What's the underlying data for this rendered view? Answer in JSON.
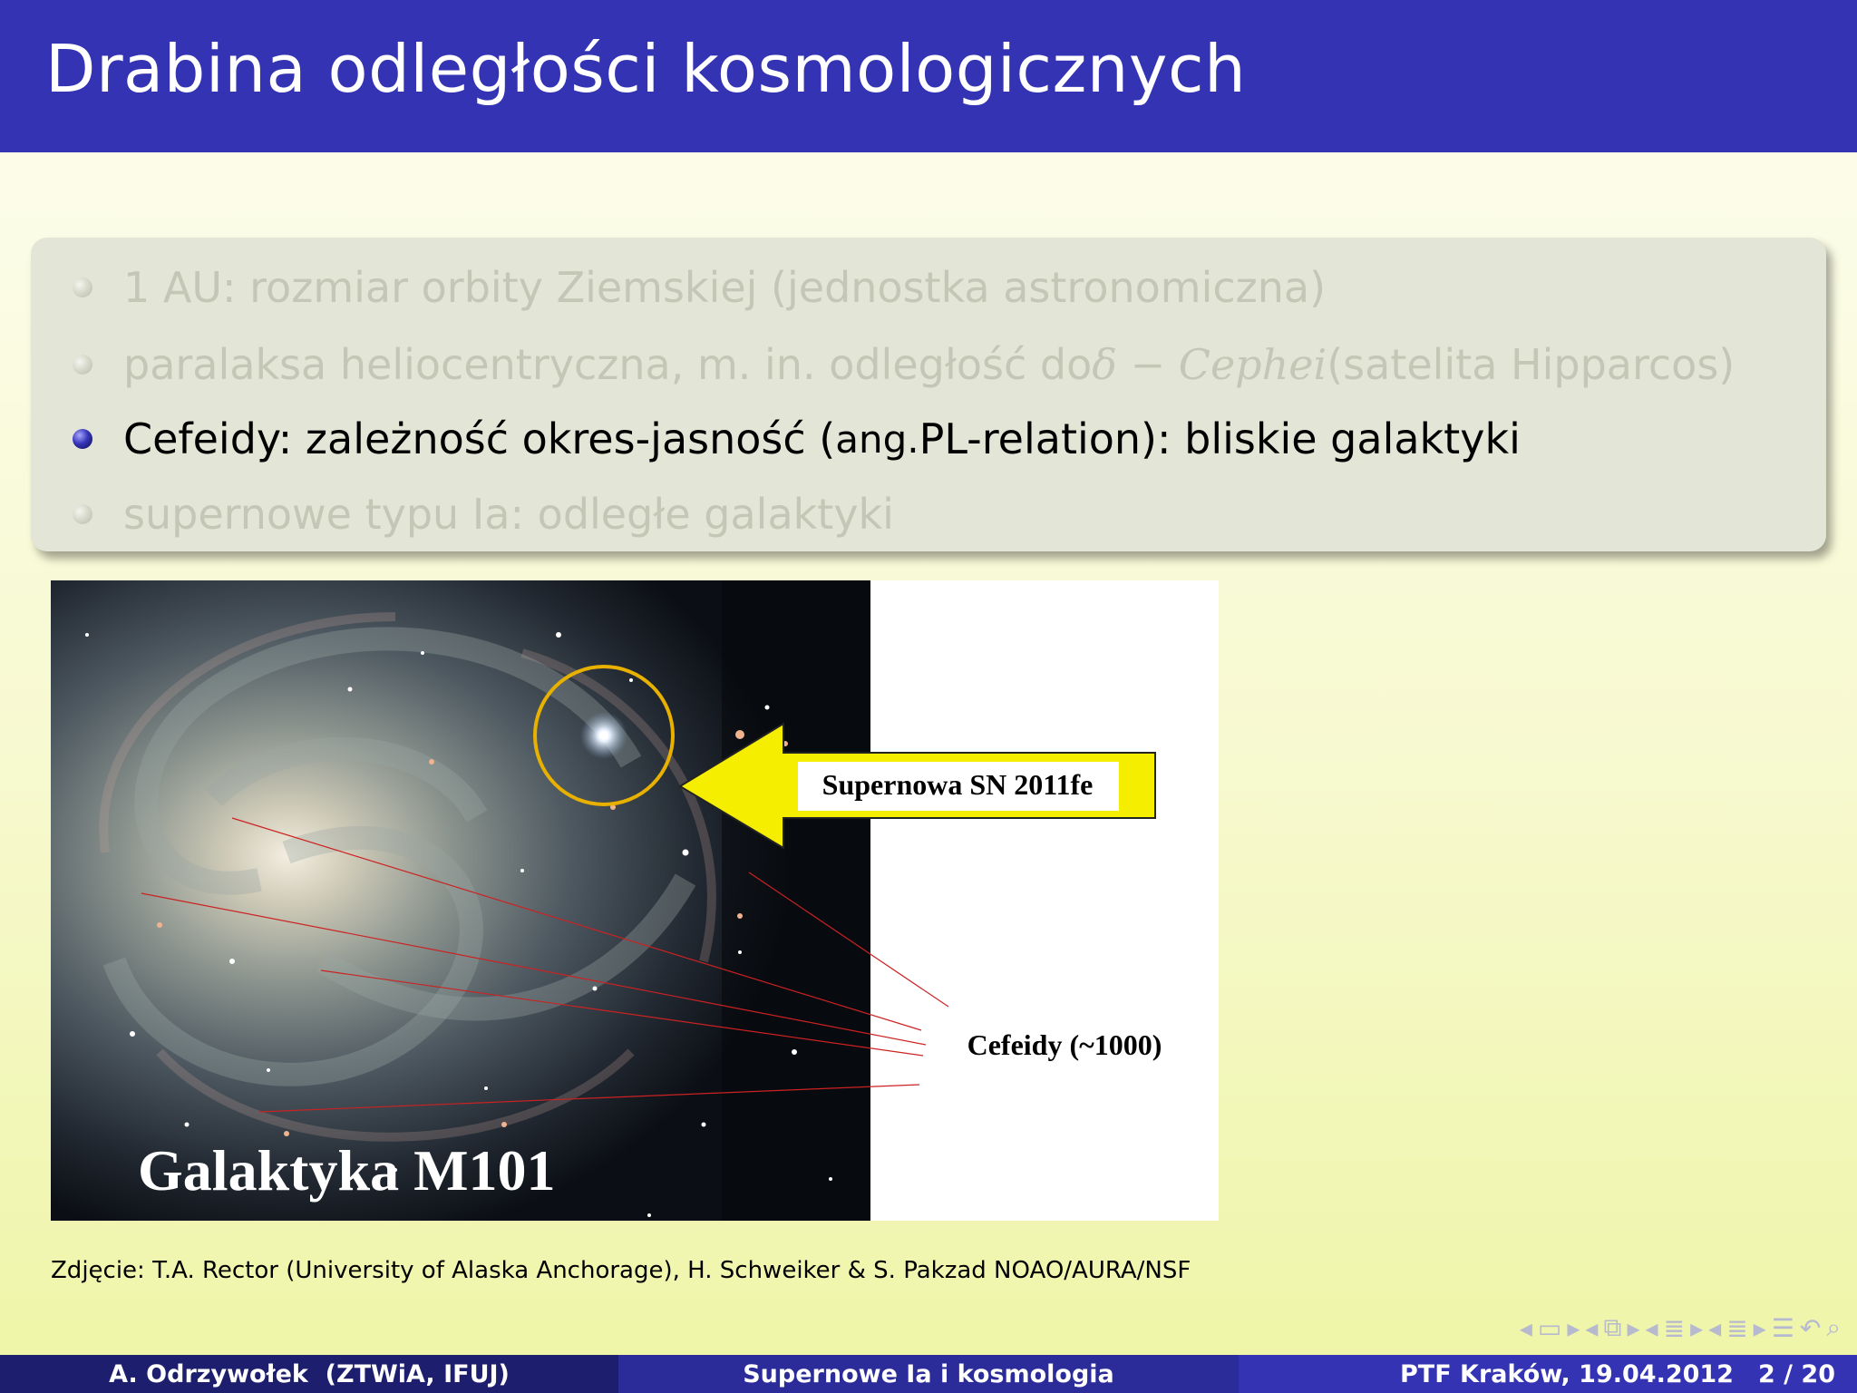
{
  "slide": {
    "title": "Drabina odległości kosmologicznych"
  },
  "bullets": [
    {
      "text": "1 AU: rozmiar orbity Ziemskiej (jednostka astronomiczna)",
      "active": false
    },
    {
      "pre": "paralaksa heliocentryczna, m. in. odległość do ",
      "math": "δ − Cephei",
      "post": " (satelita Hipparcos)",
      "active": false
    },
    {
      "pre": "Cefeidy: zależność okres-jasność (",
      "small": "ang.",
      "post": " PL-relation): bliskie galaktyki",
      "active": true
    },
    {
      "text": "supernowe typu Ia: odległe galaktyki",
      "active": false
    }
  ],
  "figure": {
    "galaxy_label": "Galaktyka M101",
    "supernova_label": "Supernowa SN 2011fe",
    "cepheids_label": "Cefeidy (~1000)",
    "caption": "Zdjęcie: T.A. Rector (University of Alaska Anchorage), H. Schweiker & S. Pakzad NOAO/AURA/NSF"
  },
  "navigation": {
    "icons": [
      "nav-prev-arrow-icon",
      "frame-icon",
      "nav-next-arrow-icon",
      "nav-prev-arrow-icon",
      "slide-icon",
      "nav-next-arrow-icon",
      "nav-prev-arrow-icon",
      "subsection-icon",
      "nav-next-arrow-icon",
      "nav-prev-arrow-icon",
      "section-icon",
      "nav-next-arrow-icon",
      "outline-icon",
      "back-icon",
      "search-icon"
    ]
  },
  "footer": {
    "author": "A. Odrzywołek  (ZTWiA, IFUJ)",
    "talk_title": "Supernowe Ia i kosmologia",
    "event": "PTF Kraków, 19.04.2012",
    "page": "2 / 20"
  },
  "colors": {
    "title_bar": "#3333b3",
    "block_bg": "#e3e5d6",
    "muted_text": "#c4c7b6",
    "arrow_fill": "#f5ee00",
    "circle_stroke": "#e8b100",
    "leader_lines": "#cc2222"
  }
}
